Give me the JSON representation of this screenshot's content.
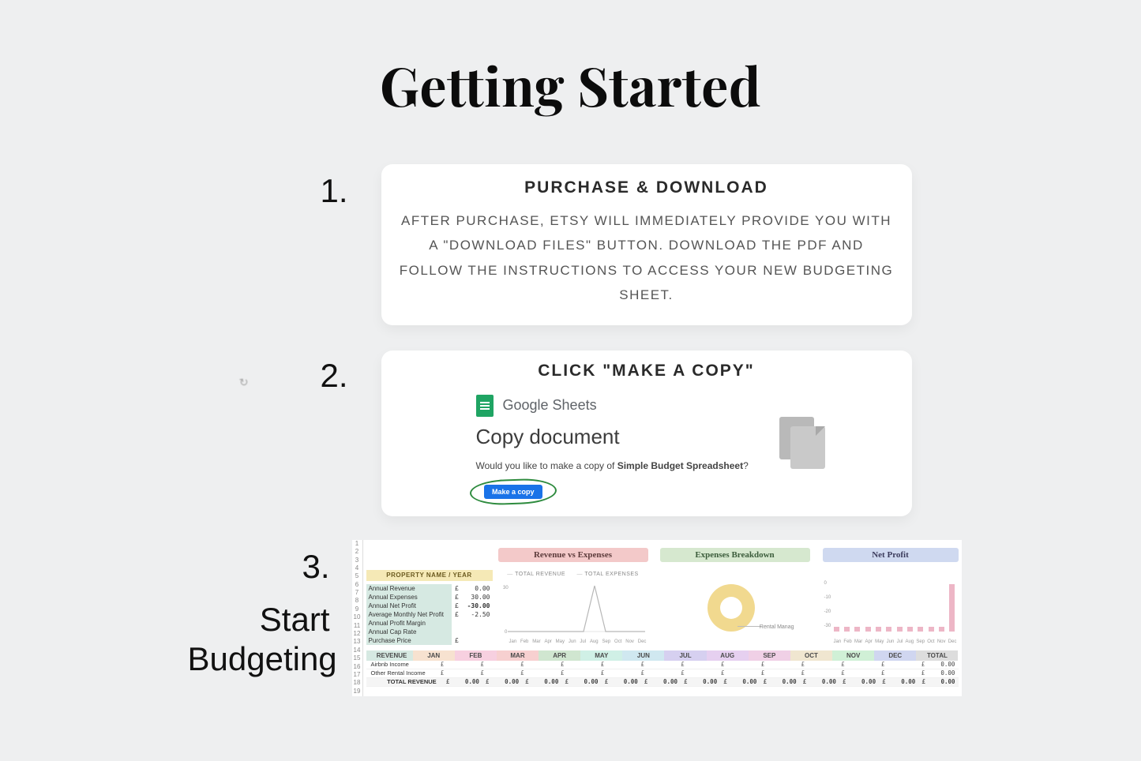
{
  "title": "Getting Started",
  "step1": {
    "num": "1.",
    "title": "PURCHASE & DOWNLOAD",
    "body": "AFTER PURCHASE, ETSY WILL IMMEDIATELY PROVIDE YOU WITH A \"DOWNLOAD FILES\" BUTTON. DOWNLOAD THE PDF AND FOLLOW THE INSTRUCTIONS TO ACCESS YOUR NEW BUDGETING SHEET."
  },
  "step2": {
    "num": "2.",
    "title": "CLICK \"MAKE A COPY\"",
    "gs_label": "Google Sheets",
    "copy_heading": "Copy document",
    "prompt_prefix": "Would you like to make a copy of ",
    "prompt_bold": "Simple Budget Spreadsheet",
    "prompt_suffix": "?",
    "button": "Make a copy"
  },
  "step3": {
    "num": "3.",
    "label_line1": "Start",
    "label_line2": "Budgeting",
    "chart_titles": {
      "rev_exp": "Revenue vs Expenses",
      "exp_break": "Expenses Breakdown",
      "net_profit": "Net Profit"
    },
    "property_header": "PROPERTY NAME / YEAR",
    "summary": [
      {
        "label": "Annual Revenue",
        "currency": "£",
        "value": "0.00",
        "bold": false
      },
      {
        "label": "Annual Expenses",
        "currency": "£",
        "value": "30.00",
        "bold": false
      },
      {
        "label": "Annual Net Profit",
        "currency": "£",
        "value": "-30.00",
        "bold": true
      },
      {
        "label": "Average Monthly Net Profit",
        "currency": "£",
        "value": "-2.50",
        "bold": false
      },
      {
        "label": "Annual Profit Margin",
        "currency": "",
        "value": "",
        "bold": false
      },
      {
        "label": "Annual Cap Rate",
        "currency": "",
        "value": "",
        "bold": false
      },
      {
        "label": "Purchase Price",
        "currency": "£",
        "value": "",
        "bold": false
      }
    ],
    "legend": {
      "a": "TOTAL REVENUE",
      "b": "TOTAL EXPENSES"
    },
    "donut_label": "Rental Manag",
    "months_short": [
      "Jan",
      "Feb",
      "Mar",
      "Apr",
      "May",
      "Jun",
      "Jul",
      "Aug",
      "Sep",
      "Oct",
      "Nov",
      "Dec"
    ],
    "month_headers": [
      "JAN",
      "FEB",
      "MAR",
      "APR",
      "MAY",
      "JUN",
      "JUL",
      "AUG",
      "SEP",
      "OCT",
      "NOV",
      "DEC"
    ],
    "revenue_label": "REVENUE",
    "total_label": "TOTAL",
    "rows": [
      {
        "label": "Airbnb Income",
        "cells": [
          "£",
          "£",
          "£",
          "£",
          "£",
          "£",
          "£",
          "£",
          "£",
          "£",
          "£",
          "£"
        ],
        "total": "0.00"
      },
      {
        "label": "Other Rental Income",
        "cells": [
          "£",
          "£",
          "£",
          "£",
          "£",
          "£",
          "£",
          "£",
          "£",
          "£",
          "£",
          "£"
        ],
        "total": "0.00"
      }
    ],
    "total_row": {
      "label": "TOTAL REVENUE",
      "cells": [
        "0.00",
        "0.00",
        "0.00",
        "0.00",
        "0.00",
        "0.00",
        "0.00",
        "0.00",
        "0.00",
        "0.00",
        "0.00",
        "0.00"
      ],
      "total": "0.00"
    }
  },
  "chart_data": [
    {
      "type": "line",
      "title": "Revenue vs Expenses",
      "x": [
        "Jan",
        "Feb",
        "Mar",
        "Apr",
        "May",
        "Jun",
        "Jul",
        "Aug",
        "Sep",
        "Oct",
        "Nov",
        "Dec"
      ],
      "series": [
        {
          "name": "TOTAL REVENUE",
          "values": [
            0,
            0,
            0,
            0,
            0,
            0,
            0,
            0,
            0,
            0,
            0,
            0
          ]
        },
        {
          "name": "TOTAL EXPENSES",
          "values": [
            0,
            0,
            0,
            0,
            0,
            0,
            0,
            30,
            0,
            0,
            0,
            0
          ]
        }
      ],
      "ylim": [
        0,
        30
      ]
    },
    {
      "type": "pie",
      "title": "Expenses Breakdown",
      "categories": [
        "Rental Manag"
      ],
      "values": [
        30
      ]
    },
    {
      "type": "bar",
      "title": "Net Profit",
      "categories": [
        "Jan",
        "Feb",
        "Mar",
        "Apr",
        "May",
        "Jun",
        "Jul",
        "Aug",
        "Sep",
        "Oct",
        "Nov",
        "Dec"
      ],
      "values": [
        0,
        0,
        0,
        0,
        0,
        0,
        0,
        0,
        0,
        0,
        0,
        -30
      ],
      "ylim": [
        -30,
        0
      ]
    }
  ]
}
